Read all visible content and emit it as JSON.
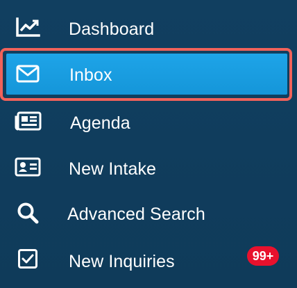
{
  "nav": {
    "items": [
      {
        "label": "Dashboard",
        "icon": "chart-line-icon",
        "active": false
      },
      {
        "label": "Inbox",
        "icon": "envelope-icon",
        "active": true
      },
      {
        "label": "Agenda",
        "icon": "newspaper-icon",
        "active": false
      },
      {
        "label": "New Intake",
        "icon": "id-card-icon",
        "active": false
      },
      {
        "label": "Advanced Search",
        "icon": "search-icon",
        "active": false
      },
      {
        "label": "New Inquiries",
        "icon": "checkbox-icon",
        "active": false,
        "badge": "99+"
      }
    ]
  },
  "colors": {
    "sidebar_bg": "#0f3d5d",
    "active_bg": "#1a9fe2",
    "highlight_border": "#f0625a",
    "badge_bg": "#e8112d",
    "text": "#ffffff"
  }
}
